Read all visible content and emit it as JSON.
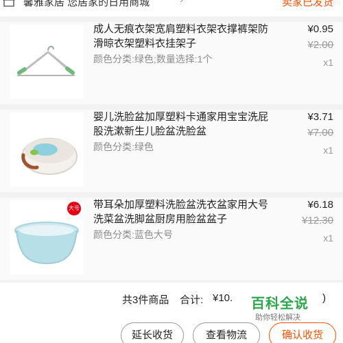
{
  "header": {
    "store_name": "馨雅家居 您居家的日用商城",
    "status": "卖家已发货"
  },
  "items": [
    {
      "title": "成人无痕衣架宽肩塑料衣架衣撑裤架防滑晾衣架塑料衣挂架子",
      "spec": "颜色分类:绿色;数量选择:1个",
      "price": "¥0.95",
      "original_price": "¥2.00",
      "qty": "x1"
    },
    {
      "title": "婴儿洗脸盆加厚塑料卡通家用宝宝洗屁股洗漱新生儿脸盆洗脸盆",
      "spec": "颜色分类:绿色",
      "price": "¥3.71",
      "original_price": "¥7.00",
      "qty": "x1"
    },
    {
      "title": "带耳朵加厚塑料洗脸盆洗衣盆家用大号洗菜盆洗脚盆厨房用脸盆盆子",
      "spec": "颜色分类:蓝色大号",
      "price": "¥6.18",
      "original_price": "¥12.30",
      "qty": "x1",
      "badge": "大号"
    }
  ],
  "summary": {
    "count": "共3件商品",
    "total_label": "合计:",
    "total_amount": "¥10.",
    "total_tail": ")"
  },
  "watermark": {
    "logo": "百科全说",
    "sub": "助你轻松解决"
  },
  "buttons": {
    "extend": "延长收货",
    "logistics": "查看物流",
    "confirm": "确认收货"
  },
  "colors": {
    "accent": "#ff5000",
    "watermark_green": "#2aa84a"
  }
}
